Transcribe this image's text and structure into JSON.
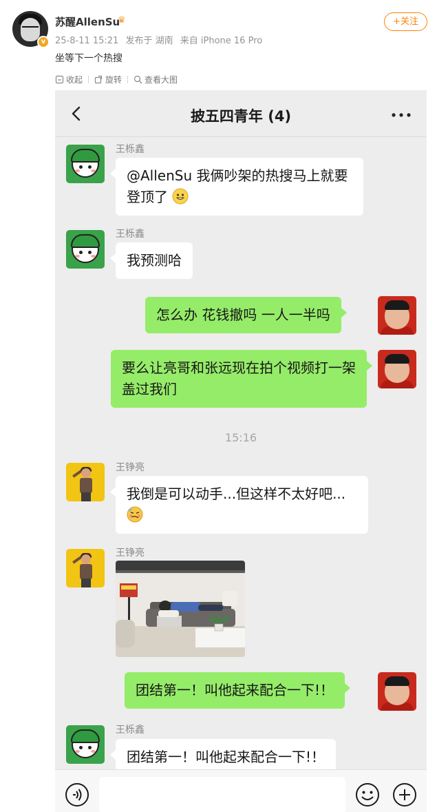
{
  "post": {
    "author_name": "苏醒AllenSu",
    "date": "25-8-11 15:21",
    "source_text": "发布于 湖南",
    "device_text": "来自 iPhone 16 Pro",
    "follow_label": "+关注",
    "text": "坐等下一个热搜",
    "verified_badge": "v"
  },
  "image_toolbar": {
    "items": [
      {
        "label": "收起",
        "icon": "collapse-icon"
      },
      {
        "label": "旋转",
        "icon": "rotate-icon"
      },
      {
        "label": "查看大图",
        "icon": "view-large-icon"
      }
    ]
  },
  "chat": {
    "title": "披五四青年 (4)",
    "timestamp": "15:16",
    "messages": [
      {
        "sender": "王栎鑫",
        "text": "@AllenSu 我俩吵架的热搜马上就要登顶了",
        "emoji": "grin-emoji",
        "side": "in"
      },
      {
        "sender": "王栎鑫",
        "text": "我预测哈",
        "side": "in"
      },
      {
        "sender": "",
        "text": "怎么办 花钱撤吗 一人一半吗",
        "side": "out"
      },
      {
        "sender": "",
        "text": "要么让亮哥和张远现在拍个视频打一架 盖过我们",
        "side": "out"
      },
      {
        "sender": "王铮亮",
        "text": "我倒是可以动手...但这样不太好吧...",
        "emoji": "woozy-emoji",
        "side": "in"
      },
      {
        "sender": "王铮亮",
        "text": "",
        "type": "photo",
        "side": "in"
      },
      {
        "sender": "",
        "text": "团结第一！叫他起来配合一下!！",
        "side": "out"
      },
      {
        "sender": "王栎鑫",
        "text": "团结第一！叫他起来配合一下!！",
        "side": "in"
      }
    ]
  },
  "colors": {
    "follow_orange": "#ff8200",
    "bubble_green": "#95ec69",
    "chat_bg": "#ededed"
  }
}
